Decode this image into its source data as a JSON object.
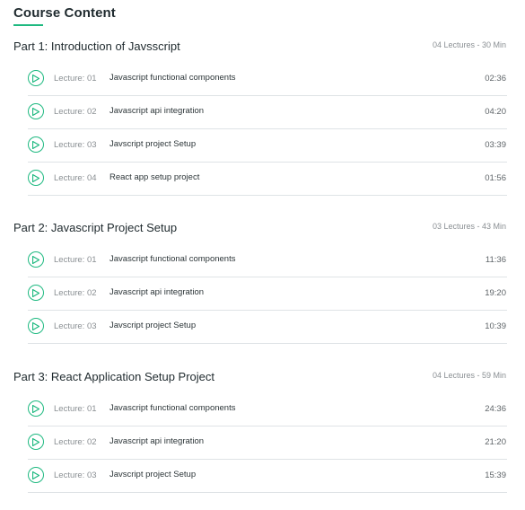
{
  "page": {
    "heading": "Course Content"
  },
  "sections": [
    {
      "title": "Part 1: Introduction of Javsscript",
      "meta": "04 Lectures - 30 Min",
      "lectures": [
        {
          "number": "Lecture: 01",
          "title": "Javascript functional components",
          "duration": "02:36"
        },
        {
          "number": "Lecture: 02",
          "title": "Javascript api integration",
          "duration": "04:20"
        },
        {
          "number": "Lecture: 03",
          "title": "Javscript project Setup",
          "duration": "03:39"
        },
        {
          "number": "Lecture: 04",
          "title": "React app setup project",
          "duration": "01:56"
        }
      ]
    },
    {
      "title": "Part 2: Javascript Project Setup",
      "meta": "03 Lectures - 43 Min",
      "lectures": [
        {
          "number": "Lecture: 01",
          "title": "Javascript functional components",
          "duration": "11:36"
        },
        {
          "number": "Lecture: 02",
          "title": "Javascript api integration",
          "duration": "19:20"
        },
        {
          "number": "Lecture: 03",
          "title": "Javscript project Setup",
          "duration": "10:39"
        }
      ]
    },
    {
      "title": "Part 3: React Application Setup Project",
      "meta": "04 Lectures - 59 Min",
      "lectures": [
        {
          "number": "Lecture: 01",
          "title": "Javascript functional components",
          "duration": "24:36"
        },
        {
          "number": "Lecture: 02",
          "title": "Javascript api integration",
          "duration": "21:20"
        },
        {
          "number": "Lecture: 03",
          "title": "Javscript project Setup",
          "duration": "15:39"
        }
      ]
    }
  ],
  "icons": {
    "lecture_play": "play-circle-icon"
  },
  "colors": {
    "accent": "#1eb980",
    "divider": "#dfe3e6",
    "muted_text": "#8a8f93"
  }
}
